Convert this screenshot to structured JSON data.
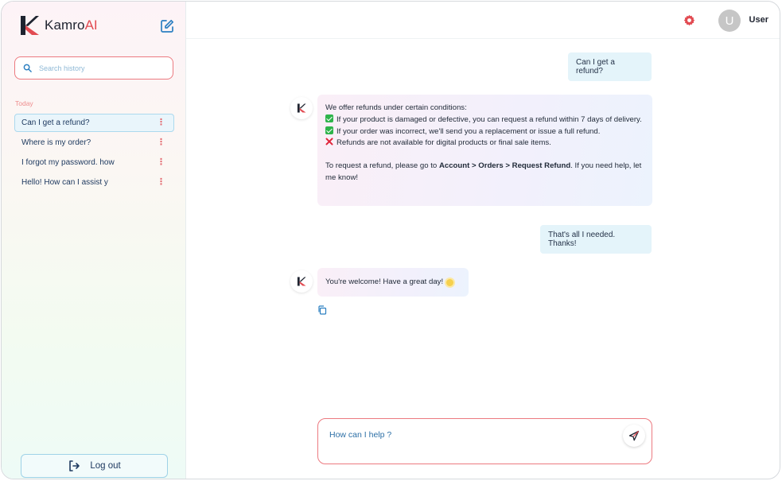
{
  "brand": {
    "name": "Kamro",
    "suffix": "AI"
  },
  "search": {
    "placeholder": "Search history"
  },
  "history": {
    "section_label": "Today",
    "items": [
      {
        "label": "Can I get a refund?",
        "active": true
      },
      {
        "label": "Where is my order?",
        "active": false
      },
      {
        "label": "I forgot my password. how",
        "active": false
      },
      {
        "label": "Hello! How can I assist y",
        "active": false
      }
    ],
    "more_icon": "⋮"
  },
  "sidebar": {
    "logout_label": "Log out"
  },
  "header": {
    "avatar_initial": "U",
    "user_name": "User"
  },
  "conversation": {
    "user_msg_1": "Can I get a refund?",
    "bot_msg_1": {
      "intro": "We offer refunds under certain conditions:",
      "item_1": "If your product is damaged or defective, you can request a refund within 7 days of delivery.",
      "item_2": "If your order was incorrect, we'll send you a replacement or issue a full refund.",
      "item_3": "Refunds are not available for digital products or final sale items.",
      "outro_start": "To request a refund, please go to ",
      "outro_path": "Account > Orders > Request Refund",
      "outro_end": ". If you need help, let me know!"
    },
    "user_msg_2": "That's all I needed. Thanks!",
    "bot_msg_2": "You're welcome! Have a great day!"
  },
  "composer": {
    "placeholder": "How can I help ?"
  },
  "colors": {
    "accent_red": "#e24b52",
    "accent_blue": "#2c6fa6",
    "user_bubble": "#e4f4fa"
  }
}
